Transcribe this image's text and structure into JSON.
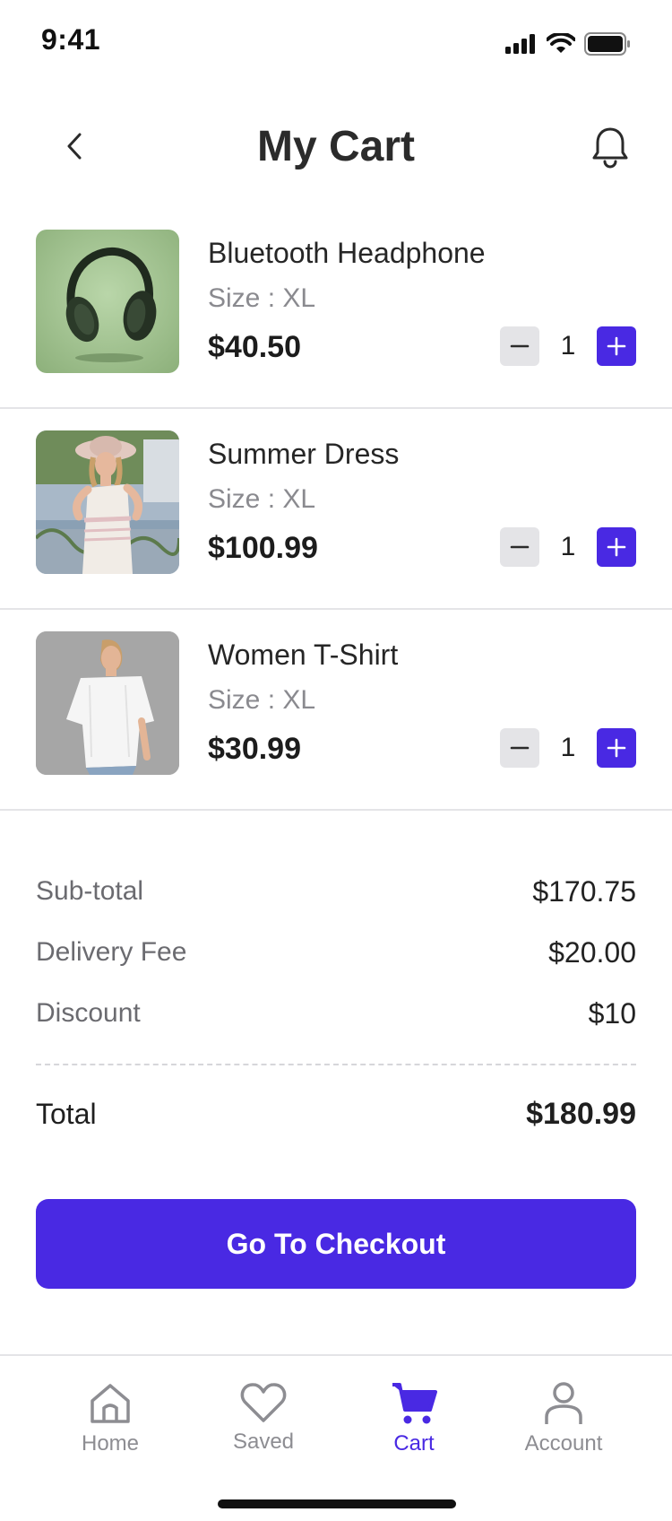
{
  "status_bar": {
    "time": "9:41"
  },
  "header": {
    "title": "My Cart"
  },
  "cart": {
    "items": [
      {
        "name": "Bluetooth Headphone",
        "size": "Size : XL",
        "price": "$40.50",
        "quantity": "1"
      },
      {
        "name": "Summer Dress",
        "size": "Size : XL",
        "price": "$100.99",
        "quantity": "1"
      },
      {
        "name": "Women T-Shirt",
        "size": "Size : XL",
        "price": "$30.99",
        "quantity": "1"
      }
    ]
  },
  "summary": {
    "subtotal_label": "Sub-total",
    "subtotal_value": "$170.75",
    "delivery_label": "Delivery Fee",
    "delivery_value": "$20.00",
    "discount_label": "Discount",
    "discount_value": "$10",
    "total_label": "Total",
    "total_value": "$180.99"
  },
  "checkout": {
    "label": "Go To Checkout"
  },
  "tabs": [
    {
      "label": "Home",
      "icon": "home-icon"
    },
    {
      "label": "Saved",
      "icon": "heart-icon"
    },
    {
      "label": "Cart",
      "icon": "cart-icon",
      "active": true
    },
    {
      "label": "Account",
      "icon": "user-icon"
    }
  ],
  "colors": {
    "accent": "#4929e3",
    "stepper_minus": "#e4e4e7",
    "divider": "#e4e4e7"
  }
}
